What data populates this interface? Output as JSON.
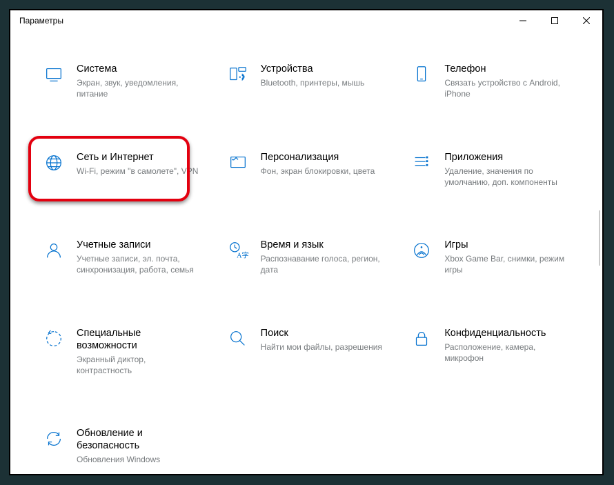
{
  "window": {
    "title": "Параметры"
  },
  "tiles": [
    {
      "name": "system",
      "title": "Система",
      "desc": "Экран, звук, уведомления, питание"
    },
    {
      "name": "devices",
      "title": "Устройства",
      "desc": "Bluetooth, принтеры, мышь"
    },
    {
      "name": "phone",
      "title": "Телефон",
      "desc": "Связать устройство с Android, iPhone"
    },
    {
      "name": "network",
      "title": "Сеть и Интернет",
      "desc": "Wi-Fi, режим \"в самолете\", VPN"
    },
    {
      "name": "personalization",
      "title": "Персонализация",
      "desc": "Фон, экран блокировки, цвета"
    },
    {
      "name": "apps",
      "title": "Приложения",
      "desc": "Удаление, значения по умолчанию, доп. компоненты"
    },
    {
      "name": "accounts",
      "title": "Учетные записи",
      "desc": "Учетные записи, эл. почта, синхронизация, работа, семья"
    },
    {
      "name": "time-language",
      "title": "Время и язык",
      "desc": "Распознавание голоса, регион, дата"
    },
    {
      "name": "gaming",
      "title": "Игры",
      "desc": "Xbox Game Bar, снимки, режим игры"
    },
    {
      "name": "ease-of-access",
      "title": "Специальные возможности",
      "desc": "Экранный диктор, контрастность"
    },
    {
      "name": "search",
      "title": "Поиск",
      "desc": "Найти мои файлы, разрешения"
    },
    {
      "name": "privacy",
      "title": "Конфиденциальность",
      "desc": "Расположение, камера, микрофон"
    },
    {
      "name": "update",
      "title": "Обновление и безопасность",
      "desc": "Обновления Windows"
    }
  ],
  "highlight_index": 3
}
